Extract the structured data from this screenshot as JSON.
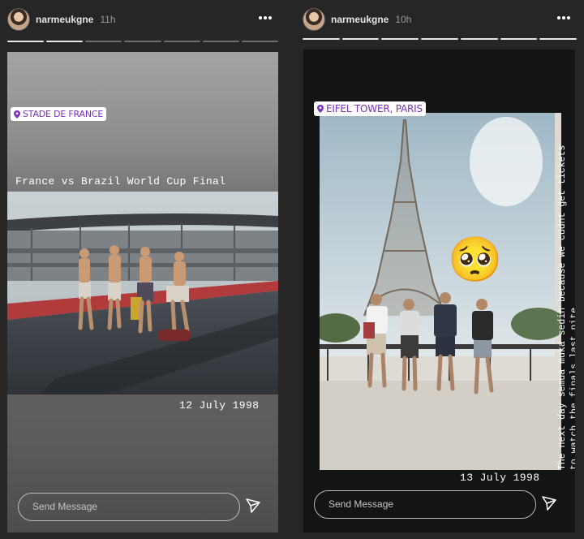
{
  "stories": [
    {
      "username": "narmeukgne",
      "time": "11h",
      "progress_done": 2,
      "progress_total": 7,
      "location_sticker": "STADE DE FRANCE",
      "caption": "France vs Brazil World Cup Final",
      "date": "12 July 1998",
      "message_placeholder": "Send Message"
    },
    {
      "username": "narmeukgne",
      "time": "10h",
      "progress_done": 7,
      "progress_total": 7,
      "location_sticker": "EIFEL TOWER, PARIS",
      "side_caption": "The next day semua muka sedih because we cudnt get tickets to watch the finals last nite",
      "date": "13 July 1998",
      "message_placeholder": "Send Message",
      "emoji": "🥺"
    }
  ],
  "colors": {
    "background": "#262626",
    "location_text": "#7b2fbe",
    "progress_done": "#e8e8e8",
    "progress_remaining": "#6d6d6d"
  },
  "icons": [
    "more-options-icon",
    "location-pin-icon",
    "send-paper-plane-icon"
  ]
}
